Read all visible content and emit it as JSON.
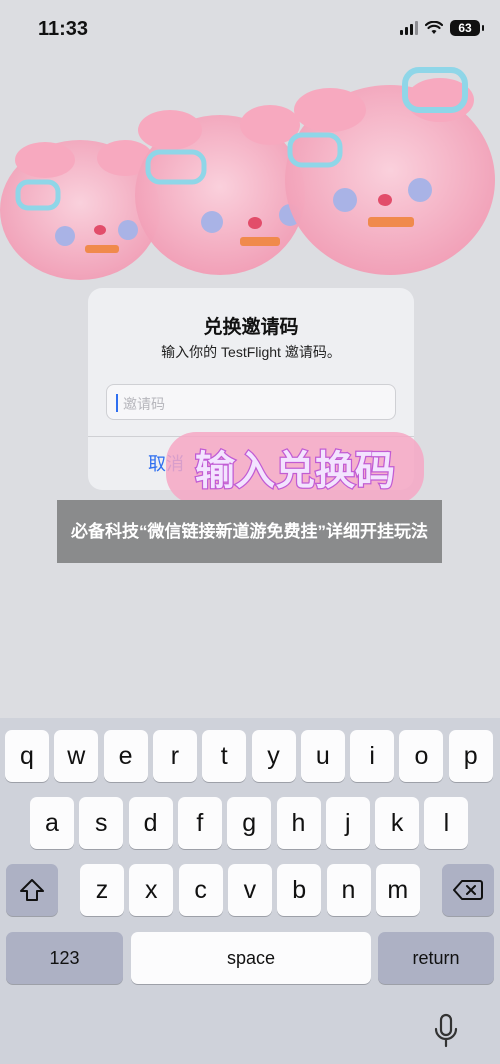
{
  "status_bar": {
    "time": "11:33",
    "battery": "63"
  },
  "dialog": {
    "title": "兑换邀请码",
    "message": "输入你的 TestFlight 邀请码。",
    "input_placeholder": "邀请码",
    "cancel_label": "取消"
  },
  "overlay_art_text": "输入兑换码",
  "caption": "必备科技“微信链接新道游免费挂”详细开挂玩法",
  "keyboard": {
    "row1": [
      "q",
      "w",
      "e",
      "r",
      "t",
      "y",
      "u",
      "i",
      "o",
      "p"
    ],
    "row2": [
      "a",
      "s",
      "d",
      "f",
      "g",
      "h",
      "j",
      "k",
      "l"
    ],
    "row3": [
      "z",
      "x",
      "c",
      "v",
      "b",
      "n",
      "m"
    ],
    "numbers_label": "123",
    "space_label": "space",
    "return_label": "return"
  },
  "icons": [
    "signal-icon",
    "wifi-icon",
    "battery-icon",
    "shift-icon",
    "delete-icon",
    "microphone-icon"
  ],
  "colors": {
    "accent": "#2f6ff0",
    "caption_bg": "#8a8b8c",
    "keyboard_bg": "#cfd2da"
  }
}
